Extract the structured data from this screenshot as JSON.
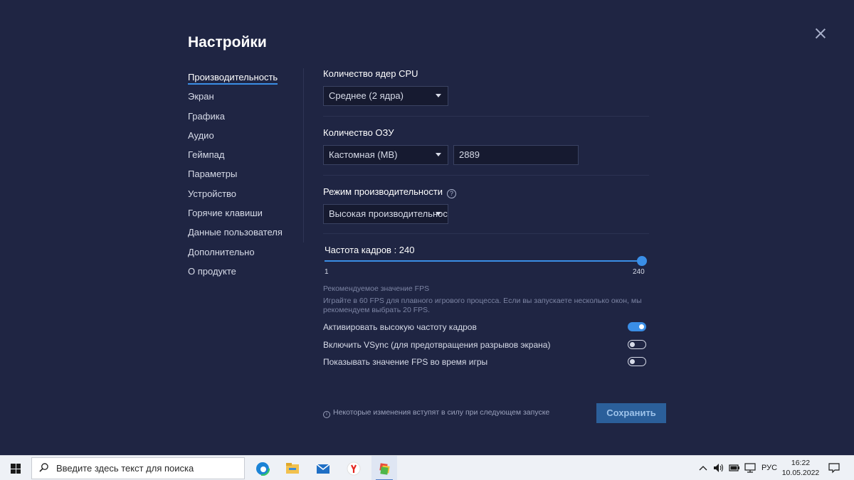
{
  "dialog": {
    "title": "Настройки",
    "close_icon": "close-icon"
  },
  "sidebar": {
    "items": [
      {
        "label": "Производительность",
        "active": true
      },
      {
        "label": "Экран"
      },
      {
        "label": "Графика"
      },
      {
        "label": "Аудио"
      },
      {
        "label": "Геймпад"
      },
      {
        "label": "Параметры"
      },
      {
        "label": "Устройство"
      },
      {
        "label": "Горячие клавиши"
      },
      {
        "label": "Данные пользователя"
      },
      {
        "label": "Дополнительно"
      },
      {
        "label": "О продукте"
      }
    ]
  },
  "performance": {
    "cpu": {
      "label": "Количество ядер CPU",
      "selected": "Среднее (2 ядра)"
    },
    "ram": {
      "label": "Количество ОЗУ",
      "selected": "Кастомная (MB)",
      "value": "2889"
    },
    "mode": {
      "label": "Режим производительности",
      "selected": "Высокая производительность",
      "help_icon": "help-icon",
      "help_glyph": "?"
    },
    "fps": {
      "label": "Частота кадров : 240",
      "value": 240,
      "min": 1,
      "max": 240,
      "min_label": "1",
      "max_label": "240"
    },
    "hint_title": "Рекомендуемое значение FPS",
    "hint_text": "Играйте в 60 FPS для плавного игрового процесса. Если вы запускаете несколько окон, мы рекомендуем выбрать 20 FPS.",
    "toggles": [
      {
        "label": "Активировать высокую частоту кадров",
        "on": true
      },
      {
        "label": "Включить VSync (для предотвращения разрывов экрана)",
        "on": false
      },
      {
        "label": "Показывать значение FPS во время игры",
        "on": false
      }
    ]
  },
  "footer": {
    "note": "Некоторые изменения вступят в силу при следующем запуске",
    "info_glyph": "i",
    "save_label": "Сохранить"
  },
  "taskbar": {
    "search_placeholder": "Введите здесь текст для поиска",
    "apps": [
      "edge-icon",
      "file-explorer-icon",
      "mail-icon",
      "yandex-browser-icon",
      "bluestacks-icon"
    ],
    "language": "РУС",
    "time": "16:22",
    "date": "10.05.2022"
  },
  "colors": {
    "background": "#1f2543",
    "accent": "#3a8ee6",
    "save_button": "#2b5f9a"
  }
}
